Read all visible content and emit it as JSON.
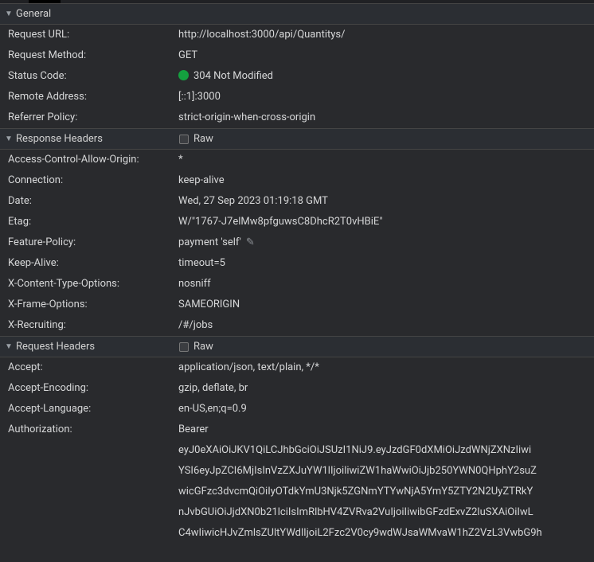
{
  "sections": {
    "general": {
      "title": "General",
      "rows": [
        {
          "label": "Request URL:",
          "value": "http://localhost:3000/api/Quantitys/"
        },
        {
          "label": "Request Method:",
          "value": "GET"
        },
        {
          "label": "Status Code:",
          "value": "304 Not Modified",
          "status_dot": true
        },
        {
          "label": "Remote Address:",
          "value": "[::1]:3000"
        },
        {
          "label": "Referrer Policy:",
          "value": "strict-origin-when-cross-origin"
        }
      ]
    },
    "response_headers": {
      "title": "Response Headers",
      "raw_label": "Raw",
      "rows": [
        {
          "label": "Access-Control-Allow-Origin:",
          "value": "*"
        },
        {
          "label": "Connection:",
          "value": "keep-alive"
        },
        {
          "label": "Date:",
          "value": "Wed, 27 Sep 2023 01:19:18 GMT"
        },
        {
          "label": "Etag:",
          "value": "W/\"1767-J7elMw8pfguwsC8DhcR2T0vHBiE\""
        },
        {
          "label": "Feature-Policy:",
          "value": "payment 'self'",
          "editable": true
        },
        {
          "label": "Keep-Alive:",
          "value": "timeout=5"
        },
        {
          "label": "X-Content-Type-Options:",
          "value": "nosniff"
        },
        {
          "label": "X-Frame-Options:",
          "value": "SAMEORIGIN"
        },
        {
          "label": "X-Recruiting:",
          "value": "/#/jobs"
        }
      ]
    },
    "request_headers": {
      "title": "Request Headers",
      "raw_label": "Raw",
      "rows": [
        {
          "label": "Accept:",
          "value": "application/json, text/plain, */*"
        },
        {
          "label": "Accept-Encoding:",
          "value": "gzip, deflate, br"
        },
        {
          "label": "Accept-Language:",
          "value": "en-US,en;q=0.9"
        },
        {
          "label": "Authorization:",
          "value": "Bearer",
          "multiline": [
            "eyJ0eXAiOiJKV1QiLCJhbGciOiJSUzI1NiJ9.eyJzdGF0dXMiOiJzdWNjZXNzIiwi",
            "YSI6eyJpZCI6MjIsInVzZXJuYW1lIjoiliwiZW1haWwiOiJjb250YWN0QHphY2suZ",
            "wicGFzc3dvcmQiOiIyOTdkYmU3Njk5ZGNmYTYwNjA5YmY5ZTY2N2UyZTRkY",
            "nJvbGUiOiJjdXN0b21lciIsImRlbHV4ZVRva2VuIjoiIiwibGFzdExvZ2luSXAiOiIwL",
            "C4wIiwicHJvZmlsZUltYWdlIjoiL2Fzc2V0cy9wdWJsaWMvaW1hZ2VzL3VwbG9h"
          ]
        }
      ]
    }
  }
}
